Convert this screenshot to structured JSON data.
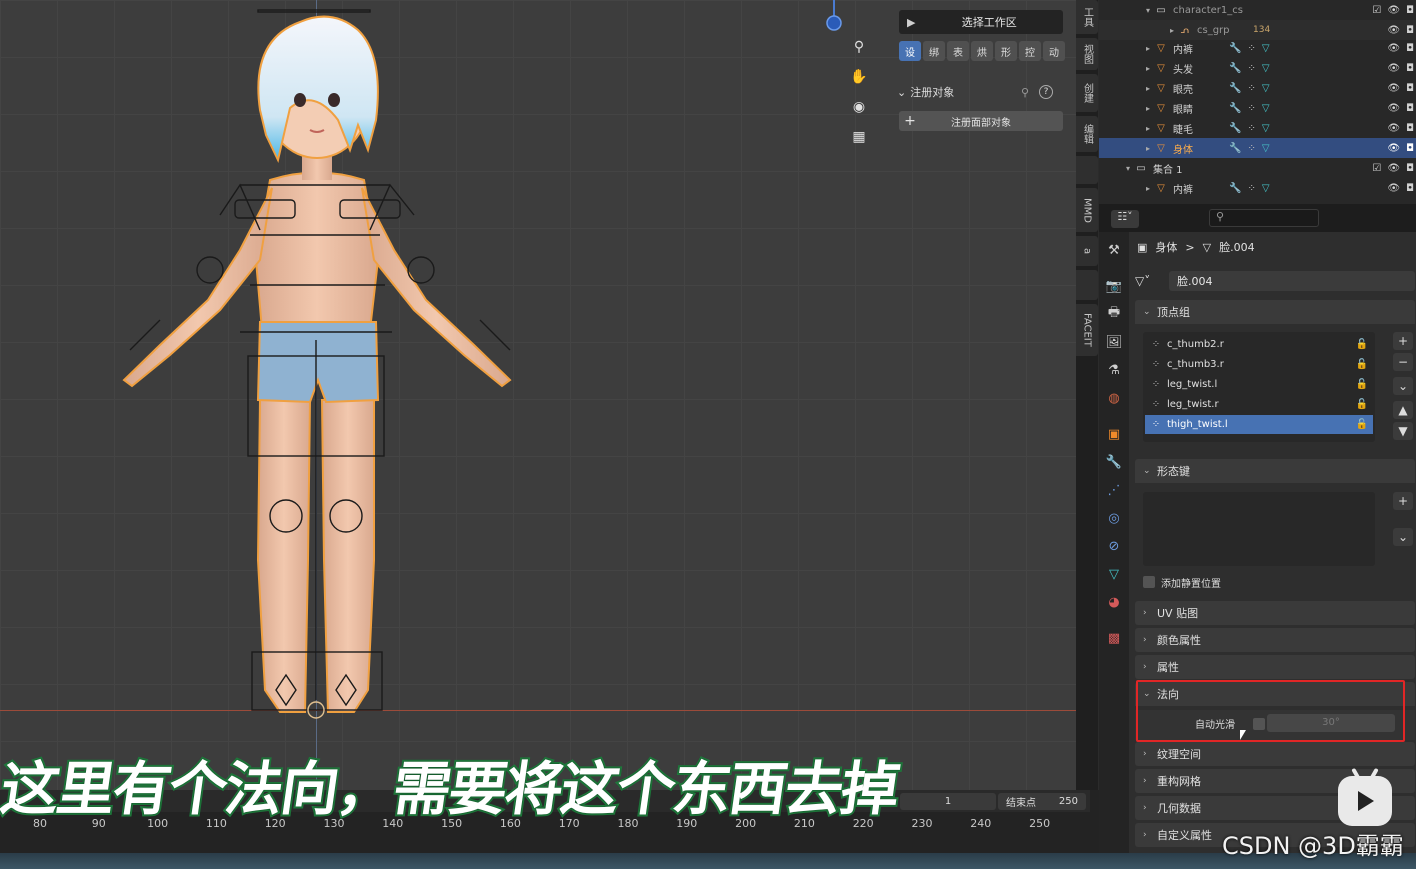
{
  "n_panel": {
    "select_workspace": "选择工作区",
    "tabs": [
      "设",
      "绑",
      "表",
      "烘",
      "形",
      "控",
      "动"
    ],
    "register_section": "注册对象",
    "register_face_button": "注册面部对象"
  },
  "vertical_tabs": [
    "工具",
    "视图",
    "创建",
    "编辑",
    "",
    "MMD",
    "a",
    "",
    "FACEIT"
  ],
  "outliner": {
    "rows": [
      {
        "name": "character1_cs",
        "type": "collection"
      },
      {
        "name": "cs_grp",
        "type": "armature",
        "badge": "134"
      },
      {
        "name": "内裤",
        "type": "mesh"
      },
      {
        "name": "头发",
        "type": "mesh"
      },
      {
        "name": "眼壳",
        "type": "mesh"
      },
      {
        "name": "眼睛",
        "type": "mesh"
      },
      {
        "name": "睫毛",
        "type": "mesh"
      },
      {
        "name": "身体",
        "type": "mesh",
        "selected": true
      },
      {
        "name": "集合 1",
        "type": "collection"
      },
      {
        "name": "内裤",
        "type": "mesh"
      }
    ]
  },
  "properties": {
    "breadcrumb_object": "身体",
    "breadcrumb_sep": ">",
    "breadcrumb_mesh": "脸.004",
    "datablock_name": "脸.004",
    "vertex_groups_title": "顶点组",
    "vertex_groups": [
      "c_thumb2.r",
      "c_thumb3.r",
      "leg_twist.l",
      "leg_twist.r",
      "thigh_twist.l"
    ],
    "active_vertex_group": "thigh_twist.l",
    "shape_keys_title": "形态键",
    "add_rest_position": "添加静置位置",
    "uv_maps": "UV 贴图",
    "color_attributes": "颜色属性",
    "attributes": "属性",
    "normals": "法向",
    "auto_smooth_label": "自动光滑",
    "auto_smooth_angle": "30°",
    "texture_space": "纹理空间",
    "remesh": "重构网格",
    "geometry_data": "几何数据",
    "custom_properties": "自定义属性"
  },
  "timeline": {
    "start_value": "1",
    "end_label": "结束点",
    "end_value": "250",
    "ticks": [
      "80",
      "90",
      "100",
      "110",
      "120",
      "130",
      "140",
      "150",
      "160",
      "170",
      "180",
      "190",
      "200",
      "210",
      "220",
      "230",
      "240",
      "250"
    ]
  },
  "overlay": {
    "subtitle": "这里有个法向，需要将这个东西去掉",
    "watermark": "CSDN @3D霸霸"
  },
  "colors": {
    "selection_outline": "#f0a040",
    "active_blue": "#4772b3",
    "highlight_red": "#e12626",
    "subtitle_stroke": "#1f7a3c"
  }
}
